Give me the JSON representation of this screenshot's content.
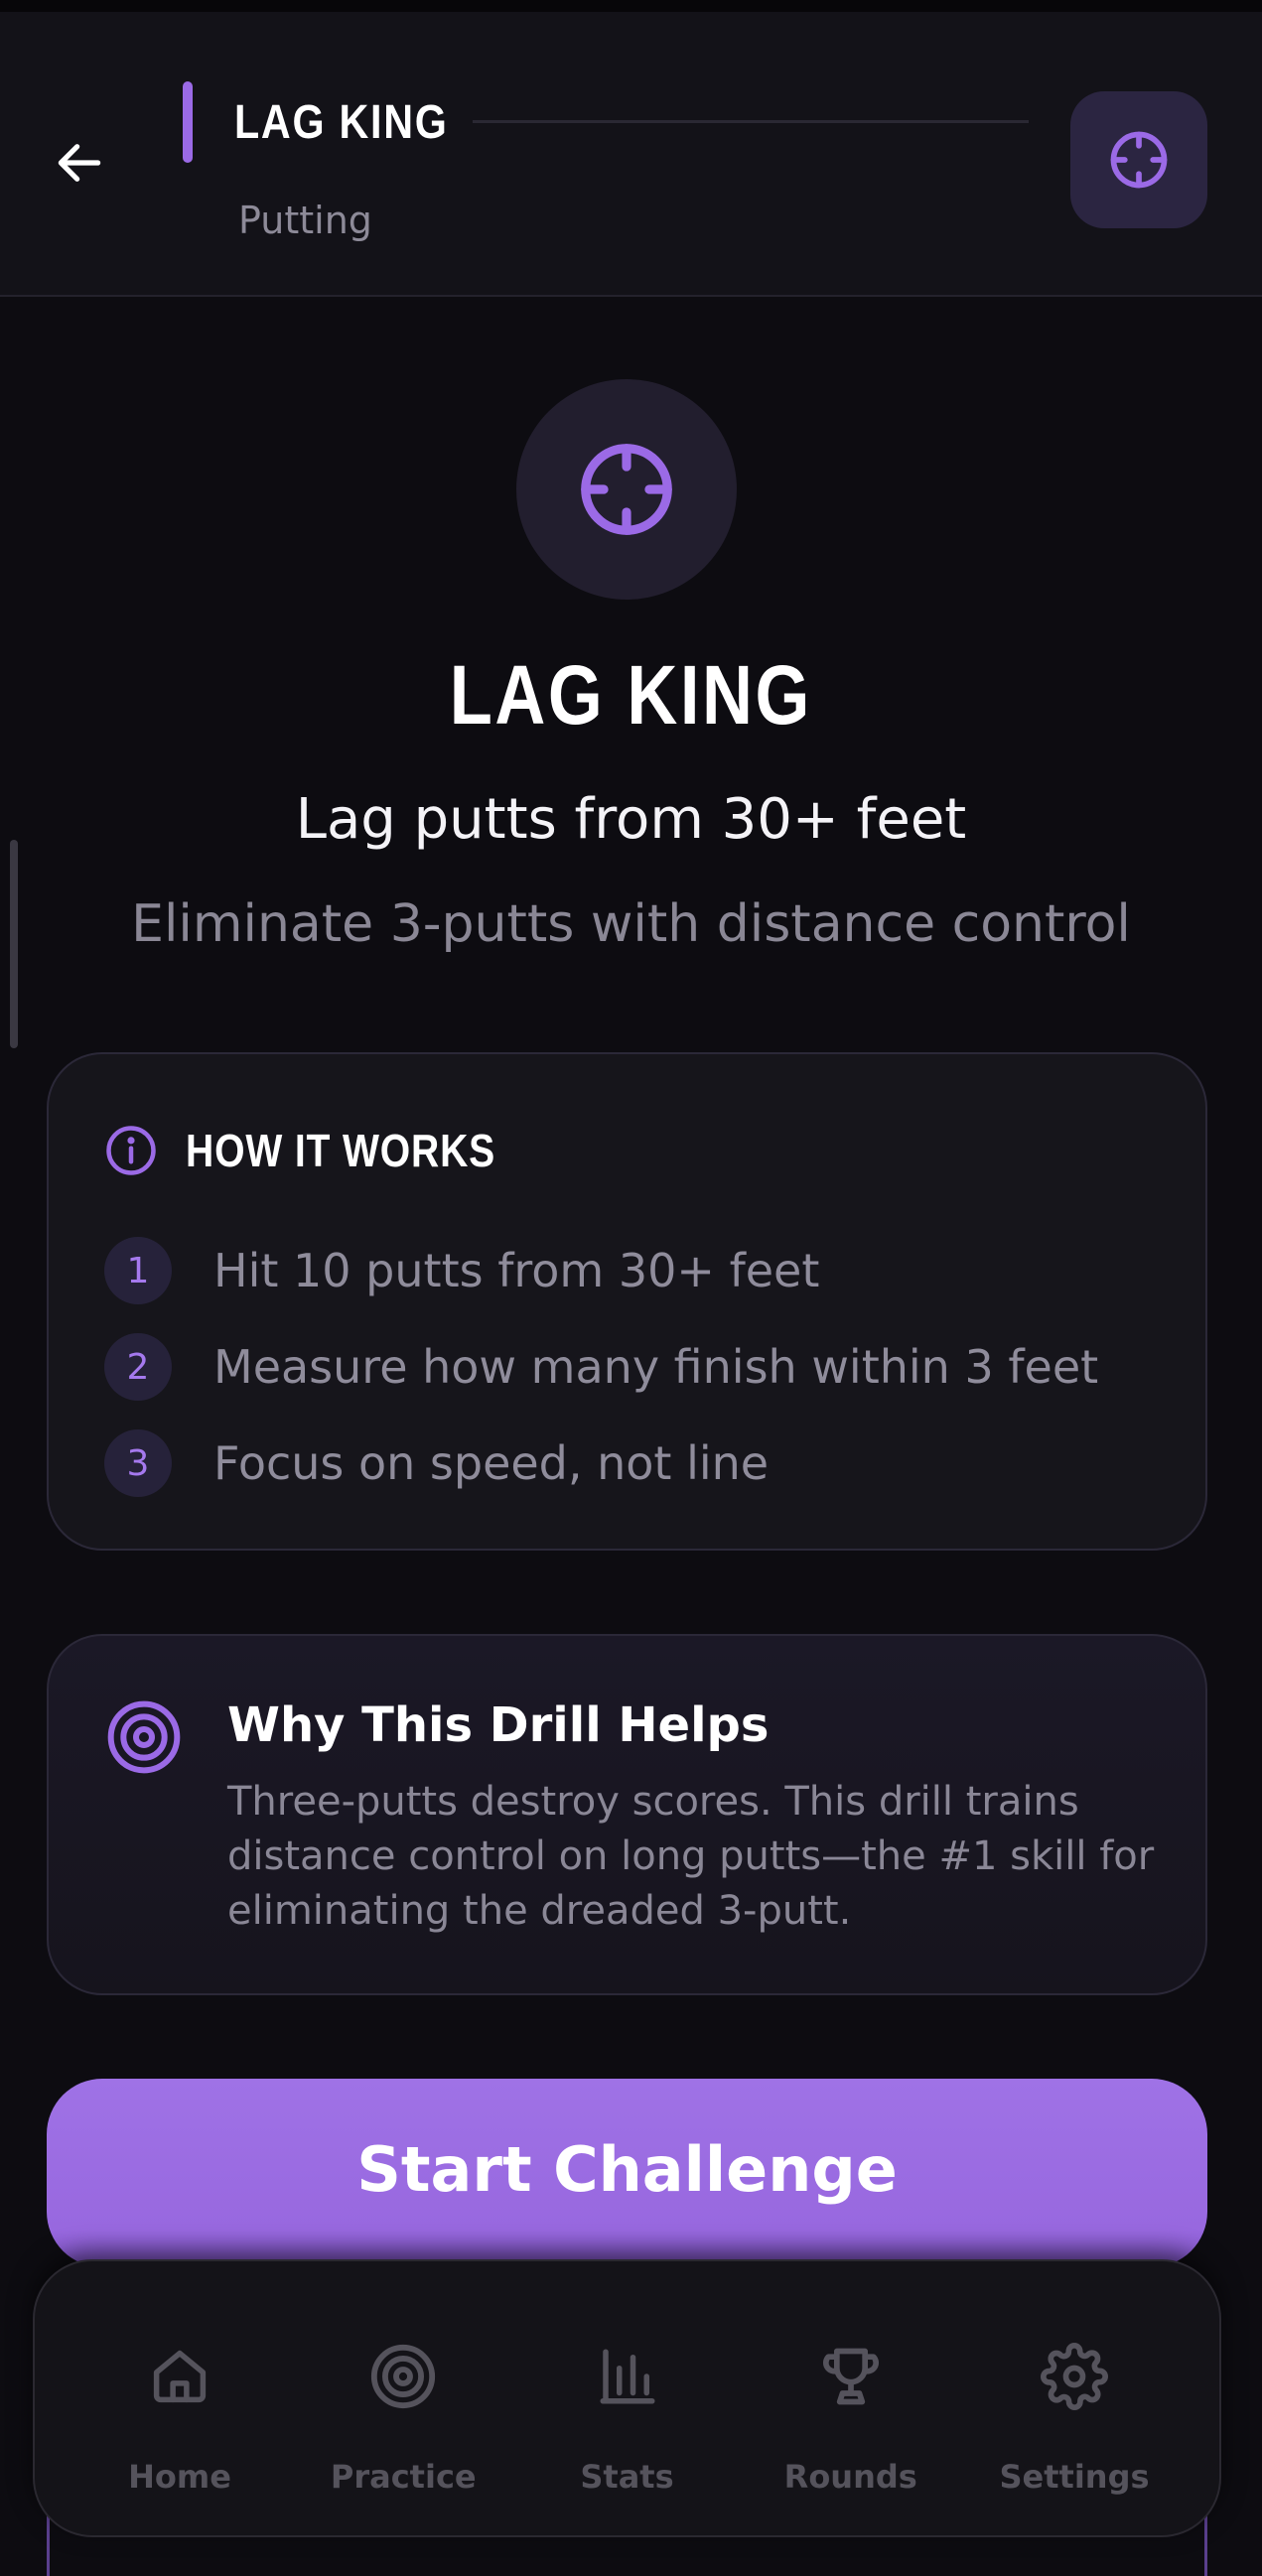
{
  "header": {
    "title": "LAG KING",
    "subtitle": "Putting"
  },
  "hero": {
    "title": "LAG KING",
    "tagline": "Lag putts from 30+ feet",
    "description": "Eliminate 3-putts with distance control"
  },
  "how_it_works": {
    "title": "HOW IT WORKS",
    "steps": [
      {
        "num": "1",
        "text": "Hit 10 putts from 30+ feet"
      },
      {
        "num": "2",
        "text": "Measure how many finish within 3 feet"
      },
      {
        "num": "3",
        "text": "Focus on speed, not line"
      }
    ]
  },
  "why": {
    "title": "Why This Drill Helps",
    "body": "Three-putts destroy scores. This drill trains distance control on long putts—the #1 skill for eliminating the dreaded 3-putt."
  },
  "cta": {
    "label": "Start Challenge"
  },
  "nav": {
    "items": [
      {
        "label": "Home",
        "icon": "home-icon"
      },
      {
        "label": "Practice",
        "icon": "target-icon"
      },
      {
        "label": "Stats",
        "icon": "bar-chart-icon"
      },
      {
        "label": "Rounds",
        "icon": "trophy-icon"
      },
      {
        "label": "Settings",
        "icon": "gear-icon"
      }
    ]
  },
  "colors": {
    "accent": "#9b6ae6",
    "background": "#0d0c11",
    "card": "#16151b",
    "muted_text": "#8a8795",
    "nav_inactive": "#55535c"
  }
}
